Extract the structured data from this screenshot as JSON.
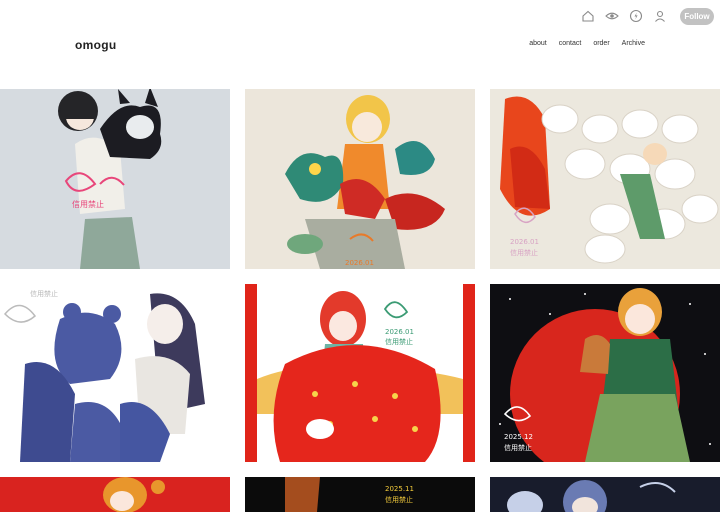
{
  "header": {
    "site_title": "omogu",
    "follow_label": "Follow",
    "icons": [
      "home-icon",
      "eye-icon",
      "lightning-icon",
      "user-icon"
    ]
  },
  "nav": {
    "items": [
      {
        "label": "about"
      },
      {
        "label": "contact"
      },
      {
        "label": "order"
      },
      {
        "label": "Archive"
      }
    ]
  },
  "gallery": {
    "tiles": [
      {
        "name": "artwork-girl-black-dog",
        "bg": "#d6dbe0"
      },
      {
        "name": "artwork-blonde-girl-plush",
        "bg": "#ece6db"
      },
      {
        "name": "artwork-sheep-pile",
        "bg": "#ece8de"
      },
      {
        "name": "artwork-blue-bears",
        "bg": "#ffffff"
      },
      {
        "name": "artwork-red-puffer",
        "bg": "#ffffff"
      },
      {
        "name": "artwork-gingerbread-night",
        "bg": "#0e0e12"
      },
      {
        "name": "artwork-row3-left",
        "bg": "#d9231f"
      },
      {
        "name": "artwork-row3-mid",
        "bg": "#0b0b0b"
      },
      {
        "name": "artwork-row3-right",
        "bg": "#181c2c"
      }
    ]
  }
}
